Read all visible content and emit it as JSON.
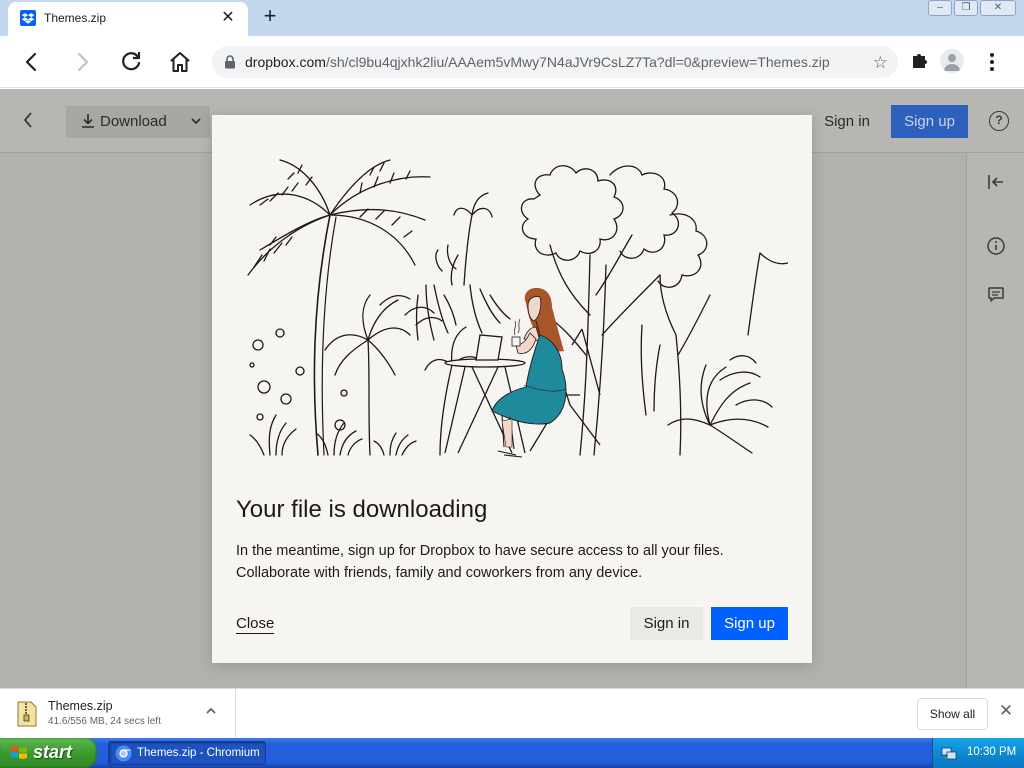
{
  "browser": {
    "tab": {
      "title": "Themes.zip",
      "close_glyph": "✕"
    },
    "new_tab_glyph": "+",
    "window_controls": [
      "–",
      "❐",
      "✕"
    ],
    "url": {
      "host": "dropbox.com",
      "path": "/sh/cl9bu4qjxhk2liu/AAAem5vMwy7N4aJVr9CsLZ7Ta?dl=0&preview=Themes.zip"
    },
    "icons": [
      "back-icon",
      "forward-icon",
      "reload-icon",
      "home-icon",
      "lock-icon",
      "star-icon",
      "extensions-icon",
      "profile-icon",
      "menu-icon"
    ]
  },
  "dropbox_page": {
    "back_glyph": "‹",
    "download_label": "Download",
    "signin_label": "Sign in",
    "signup_label": "Sign up",
    "help_glyph": "?"
  },
  "modal": {
    "title": "Your file is downloading",
    "body_line1": "In the meantime, sign up for Dropbox to have secure access to all your files.",
    "body_line2": "Collaborate with friends, family and coworkers from any device.",
    "close_label": "Close",
    "signin_label": "Sign in",
    "signup_label": "Sign up"
  },
  "download_shelf": {
    "file_name": "Themes.zip",
    "status": "41.6/556 MB, 24 secs left",
    "show_all_label": "Show all",
    "close_glyph": "✕"
  },
  "taskbar": {
    "start_label": "start",
    "task_label": "Themes.zip - Chromium",
    "clock": "10:30 PM"
  },
  "colors": {
    "dropbox_blue": "#0061fe",
    "modal_bg": "#f7f5f2",
    "dress_teal": "#1f8a9c",
    "hair": "#a8552b"
  }
}
